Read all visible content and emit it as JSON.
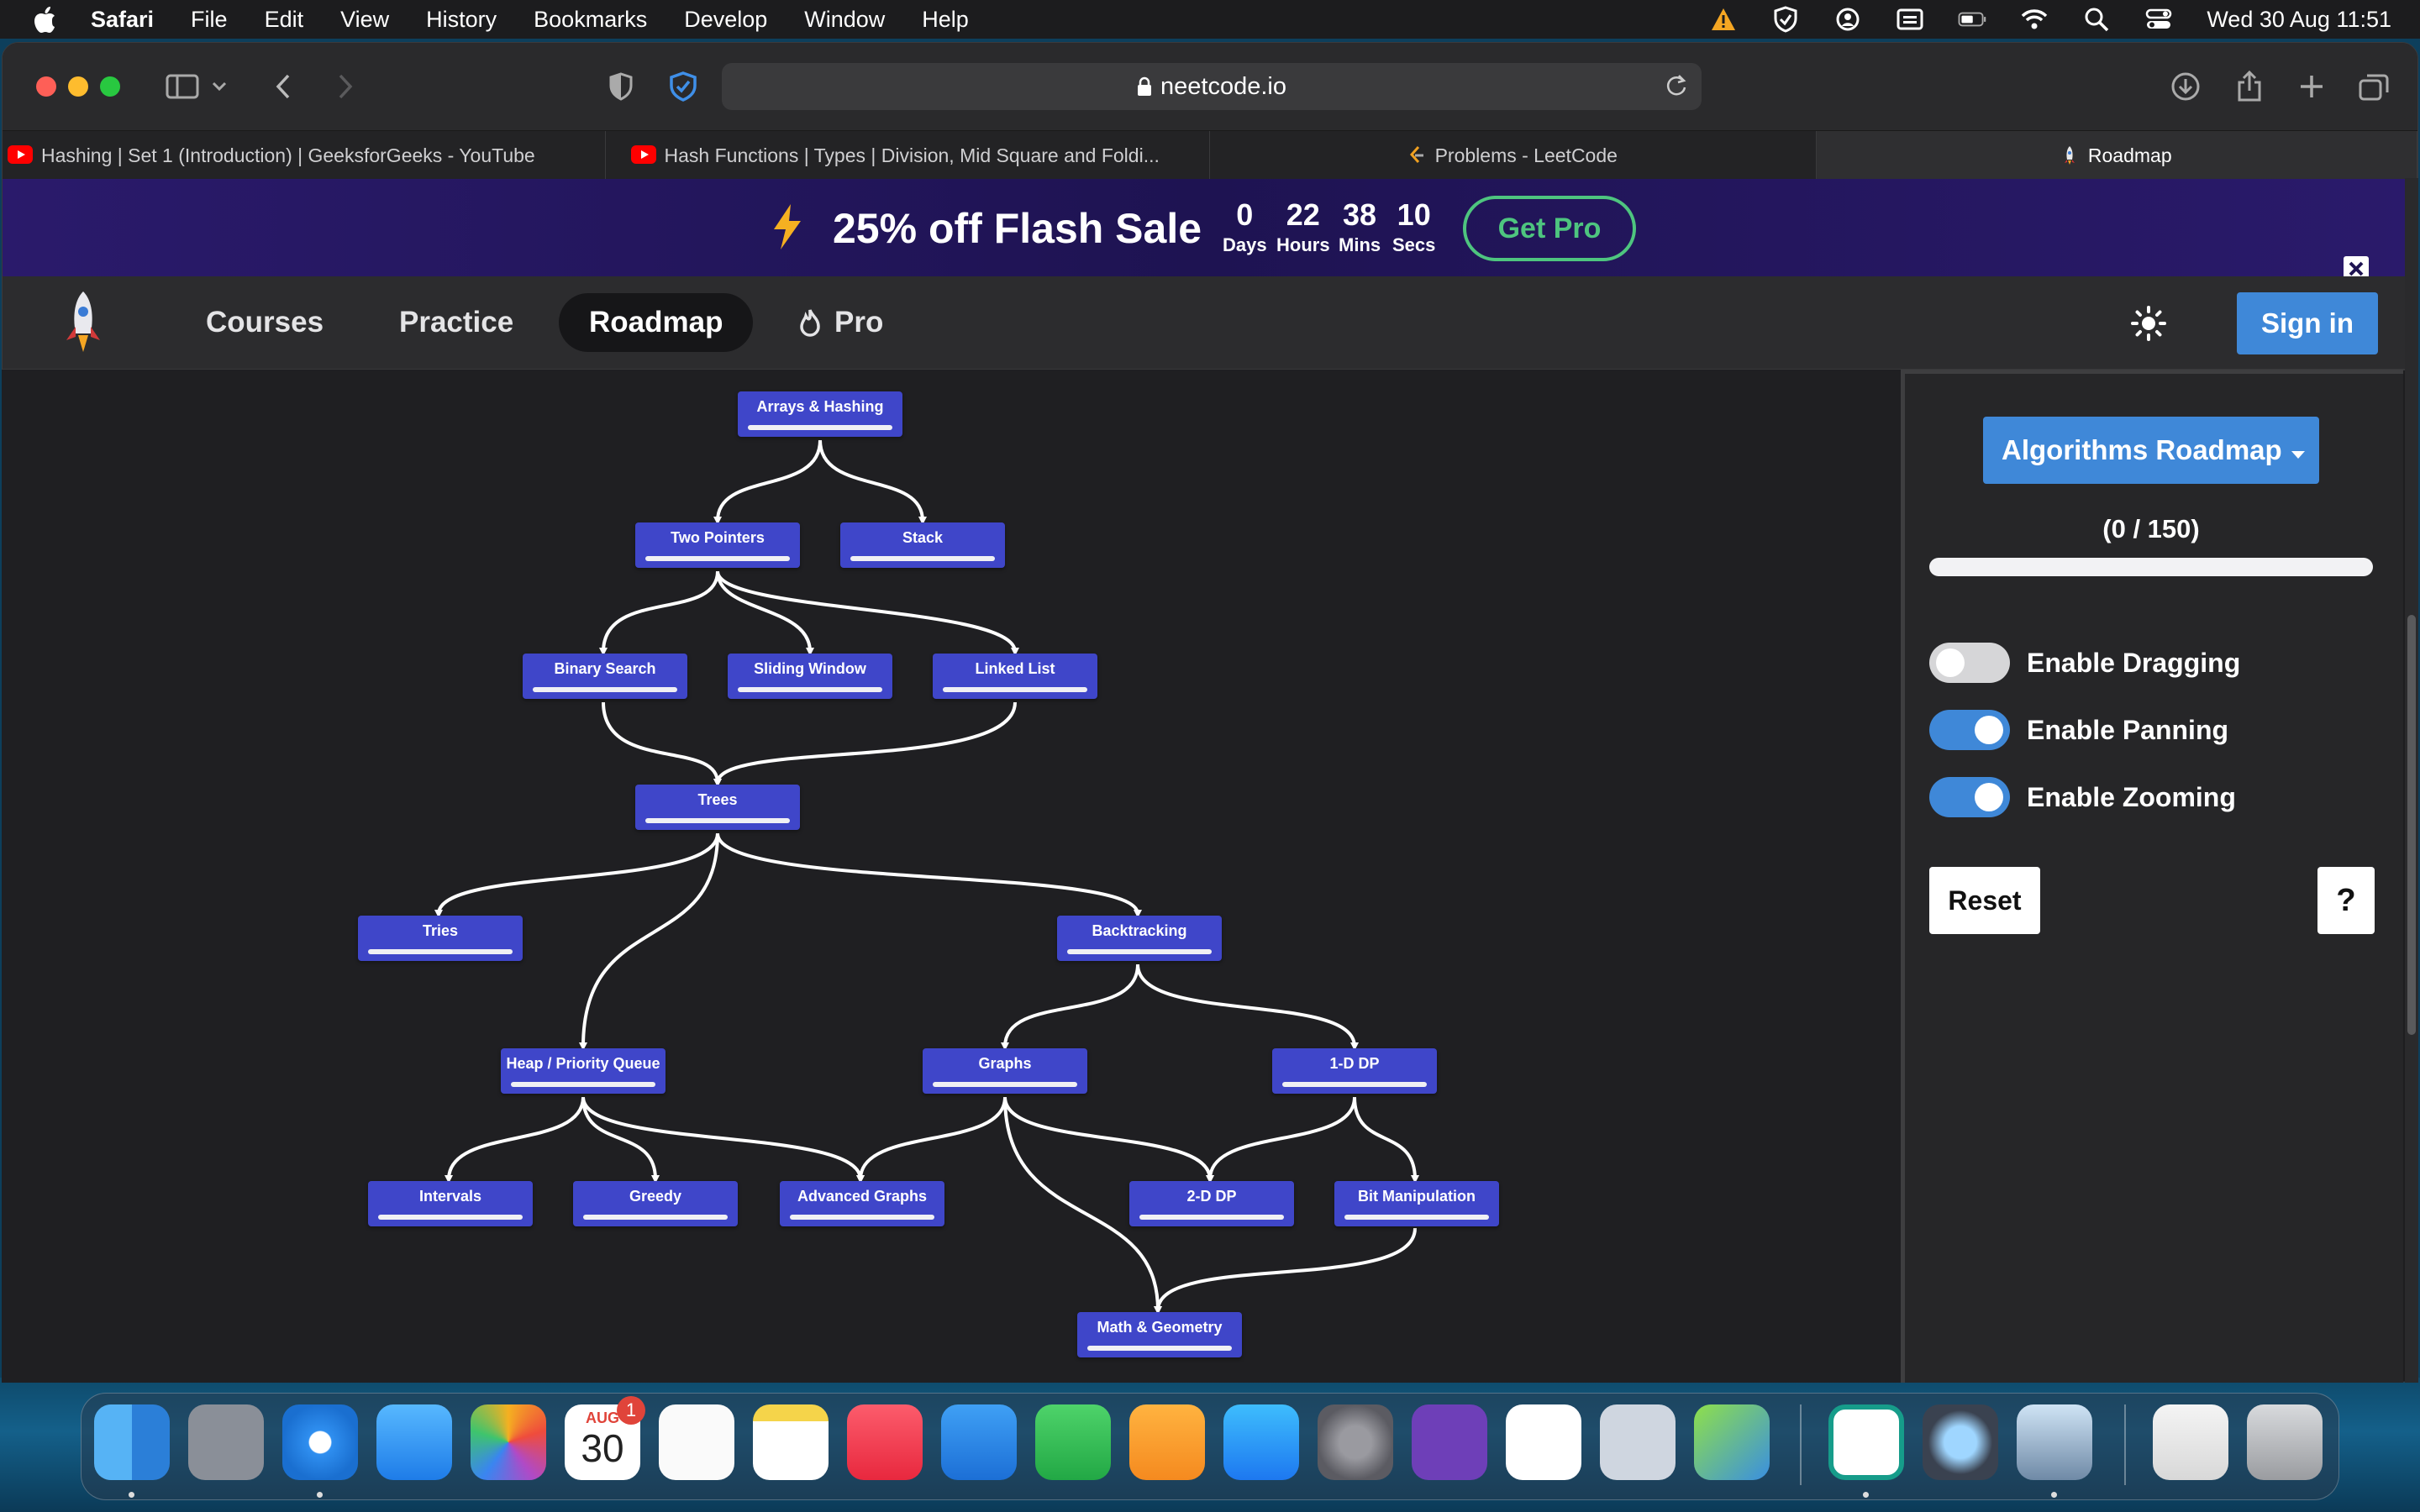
{
  "menubar": {
    "app": "Safari",
    "items": [
      "File",
      "Edit",
      "View",
      "History",
      "Bookmarks",
      "Develop",
      "Window",
      "Help"
    ],
    "clock": "Wed 30 Aug  11:51"
  },
  "browser": {
    "url": "neetcode.io",
    "tabs": [
      {
        "title": "Hashing | Set 1 (Introduction) | GeeksforGeeks - YouTube",
        "favicon": "youtube-icon"
      },
      {
        "title": "Hash Functions | Types | Division, Mid Square and Foldi...",
        "favicon": "youtube-icon"
      },
      {
        "title": "Problems - LeetCode",
        "favicon": "leetcode-icon"
      },
      {
        "title": "Roadmap",
        "favicon": "rocket-icon",
        "active": true
      }
    ]
  },
  "banner": {
    "headline": "25% off Flash Sale",
    "countdown": [
      {
        "value": "0",
        "unit": "Days"
      },
      {
        "value": "22",
        "unit": "Hours"
      },
      {
        "value": "38",
        "unit": "Mins"
      },
      {
        "value": "10",
        "unit": "Secs"
      }
    ],
    "cta": "Get Pro"
  },
  "nav": {
    "items": [
      "Courses",
      "Practice",
      "Roadmap",
      "Pro"
    ],
    "active": "Roadmap",
    "signin": "Sign in"
  },
  "roadmap": {
    "nodes": [
      {
        "id": "arrays",
        "label": "Arrays & Hashing"
      },
      {
        "id": "twoptr",
        "label": "Two Pointers"
      },
      {
        "id": "stack",
        "label": "Stack"
      },
      {
        "id": "binsearch",
        "label": "Binary Search"
      },
      {
        "id": "sliding",
        "label": "Sliding Window"
      },
      {
        "id": "linked",
        "label": "Linked List"
      },
      {
        "id": "trees",
        "label": "Trees"
      },
      {
        "id": "tries",
        "label": "Tries"
      },
      {
        "id": "backtracking",
        "label": "Backtracking"
      },
      {
        "id": "heap",
        "label": "Heap / Priority Queue"
      },
      {
        "id": "graphs",
        "label": "Graphs"
      },
      {
        "id": "dp1",
        "label": "1-D DP"
      },
      {
        "id": "intervals",
        "label": "Intervals"
      },
      {
        "id": "greedy",
        "label": "Greedy"
      },
      {
        "id": "advgraphs",
        "label": "Advanced Graphs"
      },
      {
        "id": "dp2",
        "label": "2-D DP"
      },
      {
        "id": "bitmanip",
        "label": "Bit Manipulation"
      },
      {
        "id": "math",
        "label": "Math & Geometry"
      }
    ]
  },
  "sidebar": {
    "roadmap_select": "Algorithms Roadmap",
    "progress_text": "(0 / 150)",
    "progress_value": 0,
    "toggles": [
      {
        "label": "Enable Dragging",
        "on": false
      },
      {
        "label": "Enable Panning",
        "on": true
      },
      {
        "label": "Enable Zooming",
        "on": true
      }
    ],
    "reset": "Reset",
    "help": "?"
  },
  "dock": {
    "calendar_month": "AUG",
    "calendar_day": "30",
    "calendar_badge": "1"
  }
}
